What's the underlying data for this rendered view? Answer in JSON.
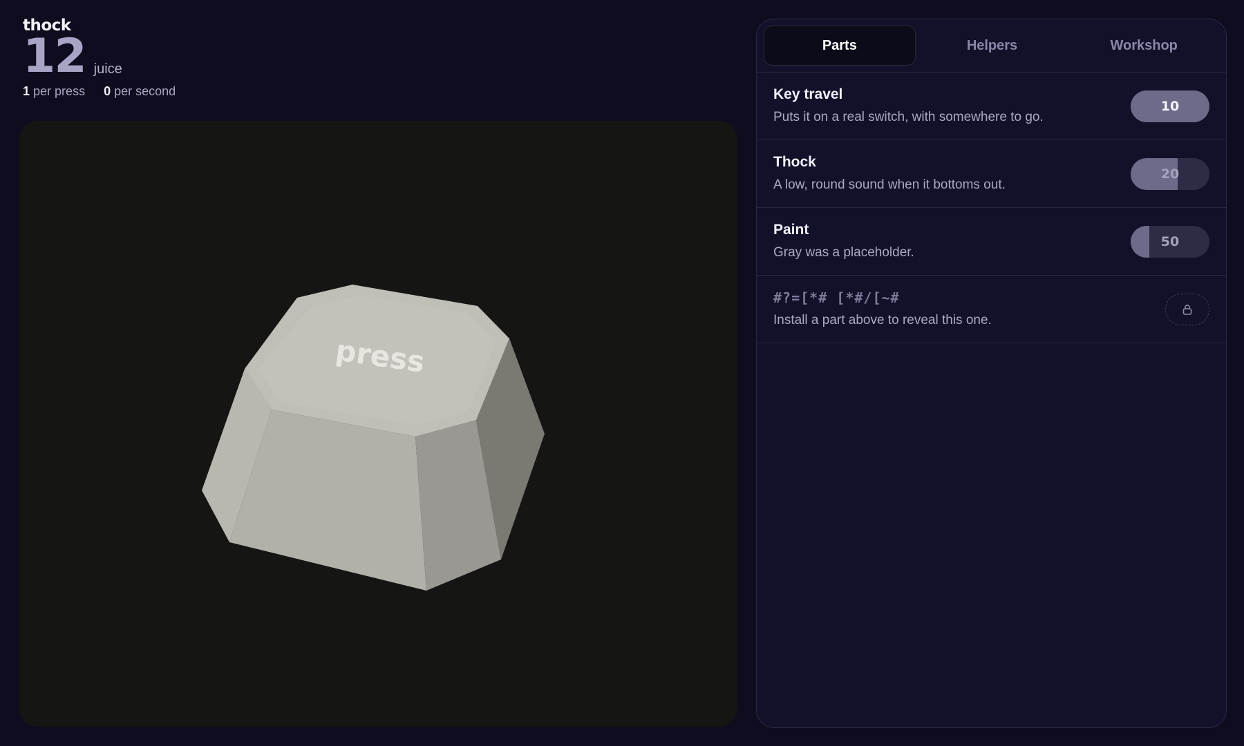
{
  "hud": {
    "brand": "thock",
    "count": "12",
    "unit": "juice",
    "per_press_value": "1",
    "per_press_label": "per press",
    "per_second_value": "0",
    "per_second_label": "per second"
  },
  "key": {
    "label": "press"
  },
  "tabs": [
    {
      "label": "Parts",
      "active": true
    },
    {
      "label": "Helpers",
      "active": false
    },
    {
      "label": "Workshop",
      "active": false
    }
  ],
  "items": [
    {
      "name": "Key travel",
      "desc": "Puts it on a real switch, with somewhere to go.",
      "cost": "10",
      "progress": 1.0
    },
    {
      "name": "Thock",
      "desc": "A low, round sound when it bottoms out.",
      "cost": "20",
      "progress": 0.6
    },
    {
      "name": "Paint",
      "desc": "Gray was a placeholder.",
      "cost": "50",
      "progress": 0.24
    },
    {
      "name": "#?=[*# [*#/[~#",
      "desc": "Install a part above to reveal this one.",
      "locked": true,
      "icon": "lock-icon"
    }
  ],
  "colors": {
    "background": "#0e0c1e",
    "panel": "#13112a",
    "stage": "#151513",
    "accent": "#a8a4c6"
  }
}
